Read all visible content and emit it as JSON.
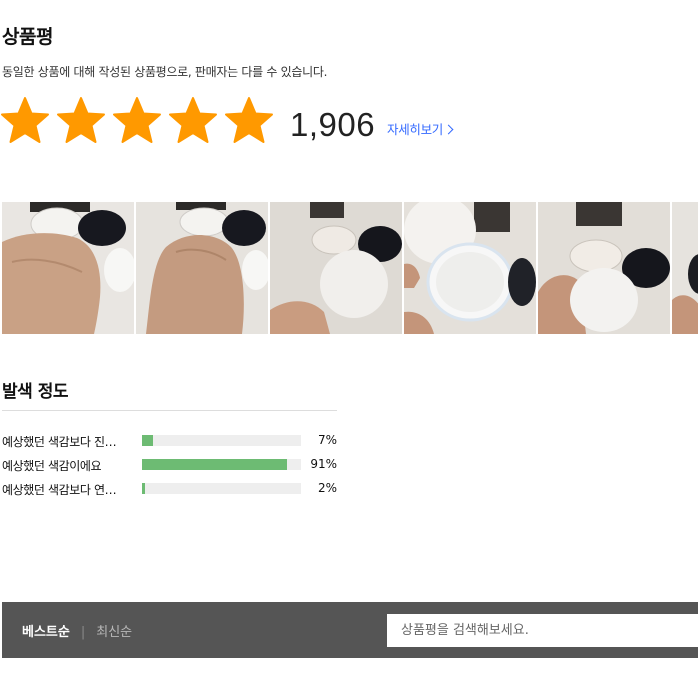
{
  "header": {
    "title": "상품평",
    "notice": "동일한 상품에 대해 작성된 상품평으로, 판매자는 다를 수 있습니다."
  },
  "rating": {
    "stars": 5,
    "max_stars": 5,
    "count": "1,906",
    "more_label": "자세히보기",
    "star_color": "#ff9900"
  },
  "photos": [
    {
      "name": "review-photo-hand-1"
    },
    {
      "name": "review-photo-hand-2"
    },
    {
      "name": "review-photo-puff-1"
    },
    {
      "name": "review-photo-powder-open"
    },
    {
      "name": "review-photo-puff-2"
    },
    {
      "name": "review-photo-partial"
    }
  ],
  "survey": {
    "title": "발색 정도",
    "bar_color": "#6dbb73",
    "items": [
      {
        "label": "예상했던 색감보다 진…",
        "value": 7,
        "pct_label": "7%"
      },
      {
        "label": "예상했던 색감이에요",
        "value": 91,
        "pct_label": "91%"
      },
      {
        "label": "예상했던 색감보다 연…",
        "value": 2,
        "pct_label": "2%"
      }
    ]
  },
  "toolbar": {
    "sort_best": "베스트순",
    "sort_separator": "|",
    "sort_latest": "최신순",
    "search_placeholder": "상품평을 검색해보세요."
  }
}
